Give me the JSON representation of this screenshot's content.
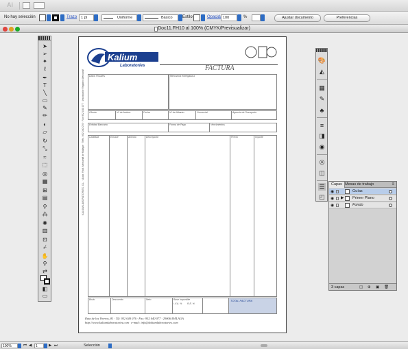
{
  "app": {
    "ai_label": "Ai"
  },
  "control_bar": {
    "selection_label": "No hay selección",
    "trazo_label": "Trazo",
    "stroke_width": "1 pt",
    "uniforme_label": "Uniforme",
    "basico_label": "Básico",
    "estilo_label": "Estilo",
    "opacidad_label": "Opacidad",
    "opacity_value": "100",
    "opacity_unit": "%",
    "ajustar_documento": "Ajustar documento",
    "preferencias": "Preferencias"
  },
  "document": {
    "title": "Doc11.FH10 al 100% (CMYK/Previsualizar)"
  },
  "invoice": {
    "brand": "Kalium",
    "brand_sub": "Laboratories",
    "heading": "FACTURA",
    "fields": {
      "datos_fiscales": "Datos Fiscales",
      "mercancia": "Mercancía entregada a",
      "cliente": "Cliente",
      "num_factura": "Nº de factura",
      "fecha": "Fecha",
      "num_albaran": "Nº de Albarán",
      "comercial": "Comercial",
      "agencia": "Agencia de Transporte",
      "entidad": "Entidad Bancaria",
      "forma_pago": "Forma de Pago",
      "vencimientos": "Vencimientos"
    },
    "columns": [
      "Cantidad",
      "Envase",
      "Artículo",
      "Descripción",
      "Precio",
      "Importe"
    ],
    "totals": [
      "Bruto",
      "Descuento",
      "Neto",
      "Base Imponible",
      "I.V.A. %",
      "R.E. %"
    ],
    "total_label": "TOTAL FACTURA",
    "side_text": "KALIUM LABORATORIES, S.L. · Avda. Ppal. Mercantil de Málaga · Telfs. 952 040 076 · Fax 952 040 077 · Inscripción Registro Mercantil",
    "footer_line1": "Ruta de los Viveros, 81 · Tlf: 952 040 076 · Fax: 952 040 077 · 29006 MÁLAGA",
    "footer_line2": "http://www.kaliumlaboratories.com · e-mail: info@kaliumlaboratories.com"
  },
  "layers_panel": {
    "tabs": [
      "Capas",
      "Mesas de trabajo"
    ],
    "layers": [
      "Guías",
      "Primer Plano",
      "Fondo"
    ],
    "count": "3 capas"
  },
  "status_bar": {
    "zoom": "100%",
    "page": "1",
    "mode": "Selección"
  }
}
